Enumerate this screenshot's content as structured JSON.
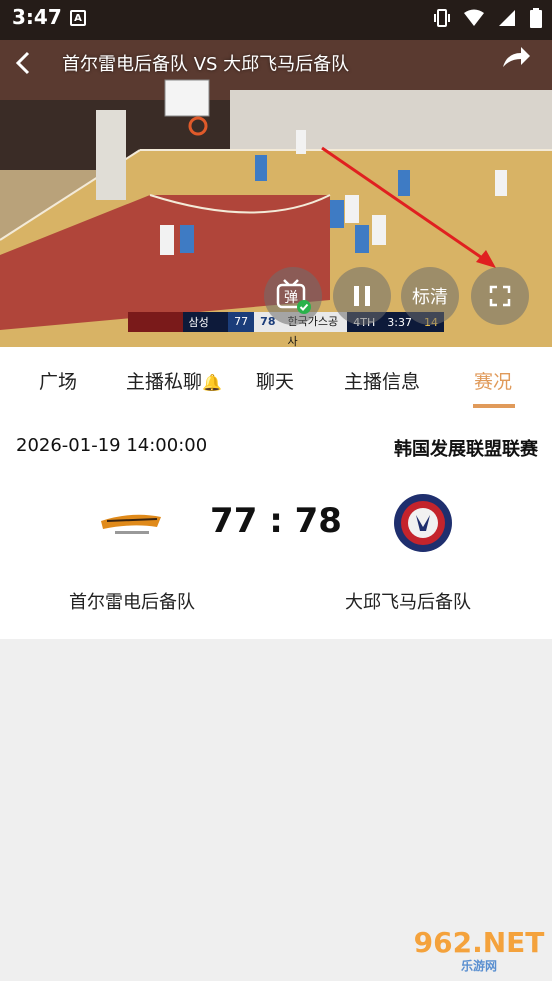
{
  "status_bar": {
    "time": "3:47",
    "notification_glyph": "A"
  },
  "video": {
    "title": "首尔雷电后备队 VS 大邱飞马后备队",
    "controls": {
      "danmaku_label": "弹",
      "quality_label": "标清"
    },
    "scoreboard": {
      "home_name": "삼성",
      "home_score": "77",
      "away_score": "78",
      "away_name": "한국가스공사",
      "period": "4TH",
      "clock": "3:37",
      "shot_clock": "14"
    }
  },
  "tabs": [
    {
      "label": "广场",
      "active": false
    },
    {
      "label": "主播私聊",
      "active": false
    },
    {
      "label": "聊天",
      "active": false
    },
    {
      "label": "主播信息",
      "active": false
    },
    {
      "label": "赛况",
      "active": true
    }
  ],
  "match": {
    "datetime": "2026-01-19 14:00:00",
    "league": "韩国发展联盟联赛",
    "score": "77 : 78",
    "home_team": "首尔雷电后备队",
    "away_team": "大邱飞马后备队"
  },
  "watermark": {
    "main": "962.NET",
    "sub": "乐游网"
  },
  "colors": {
    "accent": "#e09a5a",
    "background": "#efefef"
  }
}
